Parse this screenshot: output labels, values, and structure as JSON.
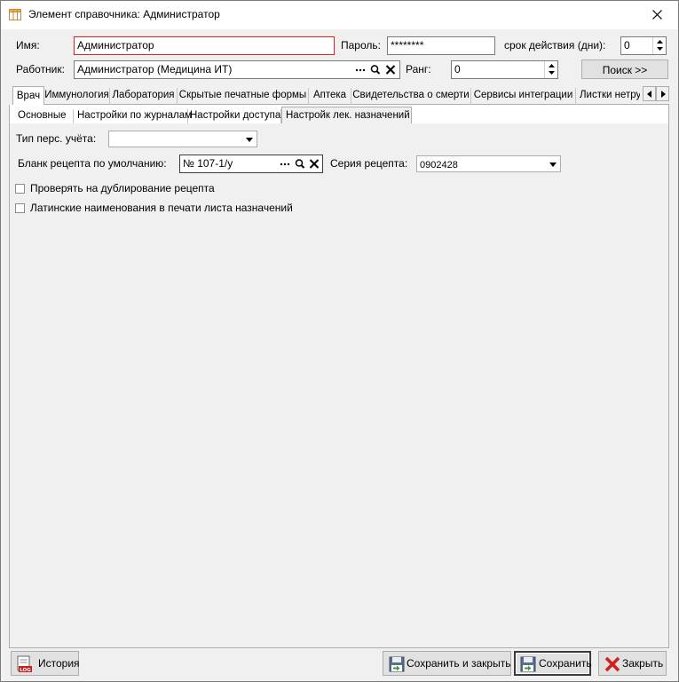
{
  "window": {
    "title": "Элемент справочника: Администратор",
    "icon": "table-icon",
    "close_icon": "close-icon"
  },
  "header": {
    "name_label": "Имя:",
    "name_value": "Администратор",
    "password_label": "Пароль:",
    "password_value": "********",
    "validity_label": "срок действия (дни):",
    "validity_value": "0",
    "worker_label": "Работник:",
    "worker_value": "Администратор (Медицина ИТ)",
    "rank_label": "Ранг:",
    "rank_value": "0",
    "search_button": "Поиск  >>"
  },
  "main_tabs": [
    {
      "label": "Врач",
      "active": true
    },
    {
      "label": "Иммунология",
      "active": false
    },
    {
      "label": "Лаборатория",
      "active": false
    },
    {
      "label": "Скрытые печатные формы",
      "active": false
    },
    {
      "label": "Аптека",
      "active": false
    },
    {
      "label": "Свидетельства о смерти",
      "active": false
    },
    {
      "label": "Сервисы интеграции",
      "active": false
    },
    {
      "label": "Листки нетру",
      "active": false
    }
  ],
  "sub_tabs": [
    {
      "label": "Основные",
      "active": false
    },
    {
      "label": "Настройки по журналам",
      "active": false
    },
    {
      "label": "Настройки доступа",
      "active": false
    },
    {
      "label": "Настройк лек. назначений",
      "active": true
    }
  ],
  "form": {
    "acc_type_label": "Тип перс. учёта:",
    "acc_type_value": "",
    "blank_label": "Бланк рецепта по умолчанию:",
    "blank_value": "№ 107-1/у",
    "series_label": "Серия рецепта:",
    "series_value": "0902428",
    "check_duplicate_label": "Проверять на дублирование рецепта",
    "check_duplicate_checked": false,
    "latin_names_label": "Латинские наименования в печати листа назначений",
    "latin_names_checked": false
  },
  "footer": {
    "history_button": "История",
    "save_close_button": "Сохранить и закрыть",
    "save_button": "Сохранить",
    "close_button": "Закрыть"
  },
  "colors": {
    "window_bg": "#f0f0f0",
    "required_border": "#e02020",
    "close_x_red": "#d0201c",
    "save_green": "#3c9a3c"
  }
}
